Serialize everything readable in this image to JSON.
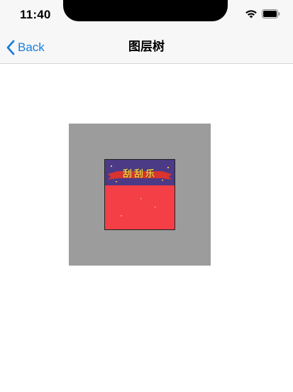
{
  "status_bar": {
    "time": "11:40",
    "wifi_icon": "wifi-icon",
    "battery_icon": "battery-icon"
  },
  "nav": {
    "back_label": "Back",
    "back_icon": "chevron-left-icon",
    "title": "图层树"
  },
  "layers": {
    "outer_color": "#9c9c9c",
    "inner_image": {
      "title_text": "刮刮乐",
      "top_color": "#4b3a86",
      "bottom_color": "#f43f46",
      "ribbon_color": "#d9342f"
    }
  }
}
